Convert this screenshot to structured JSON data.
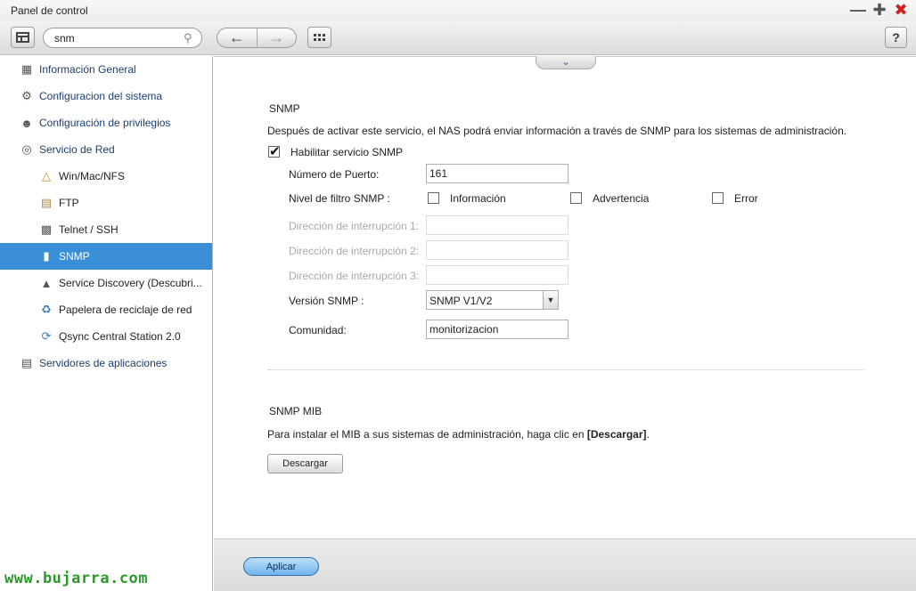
{
  "window": {
    "title": "Panel de control"
  },
  "toolbar": {
    "search_value": "snm"
  },
  "sidebar": {
    "items": [
      {
        "label": "Información General",
        "icon": "dashboard-icon",
        "level": "top"
      },
      {
        "label": "Configuracion del sistema",
        "icon": "gear-icon",
        "level": "top"
      },
      {
        "label": "Configuración de privilegios",
        "icon": "user-icon",
        "level": "top"
      },
      {
        "label": "Servicio de Red",
        "icon": "globe-icon",
        "level": "top"
      },
      {
        "label": "Win/Mac/NFS",
        "icon": "triangle-icon",
        "level": "sub"
      },
      {
        "label": "FTP",
        "icon": "folder-icon",
        "level": "sub"
      },
      {
        "label": "Telnet / SSH",
        "icon": "terminal-icon",
        "level": "sub"
      },
      {
        "label": "SNMP",
        "icon": "bar-chart-icon",
        "level": "sub",
        "active": true
      },
      {
        "label": "Service Discovery (Descubri...",
        "icon": "radar-icon",
        "level": "sub"
      },
      {
        "label": "Papelera de reciclaje de red",
        "icon": "recycle-icon",
        "level": "sub"
      },
      {
        "label": "Qsync Central Station 2.0",
        "icon": "sync-icon",
        "level": "sub"
      },
      {
        "label": "Servidores de aplicaciones",
        "icon": "server-icon",
        "level": "top"
      }
    ]
  },
  "snmp": {
    "title": "SNMP",
    "description": "Después de activar este servicio, el NAS podrá enviar información a través de SNMP para los sistemas de administración.",
    "enable_label": "Habilitar servicio SNMP",
    "enabled": true,
    "port_label": "Número de Puerto:",
    "port_value": "161",
    "filter_label": "Nivel de filtro SNMP :",
    "filter_options": [
      {
        "label": "Información",
        "checked": false
      },
      {
        "label": "Advertencia",
        "checked": false
      },
      {
        "label": "Error",
        "checked": false
      }
    ],
    "trap1_label": "Dirección de interrupción 1:",
    "trap2_label": "Dirección de interrupción 2:",
    "trap3_label": "Dirección de interrupción 3:",
    "version_label": "Versión SNMP :",
    "version_value": "SNMP V1/V2",
    "community_label": "Comunidad:",
    "community_value": "monitorizacion"
  },
  "mib": {
    "title": "SNMP MIB",
    "description_prefix": "Para instalar el MIB a sus sistemas de administración, haga clic en ",
    "description_bold": "[Descargar]",
    "description_suffix": ".",
    "download_label": "Descargar"
  },
  "footer": {
    "apply_label": "Aplicar"
  },
  "watermark": "www.bujarra.com",
  "colors": {
    "accent": "#3a8fd6",
    "close": "#d21f1f",
    "watermark": "#2b9a2b"
  }
}
